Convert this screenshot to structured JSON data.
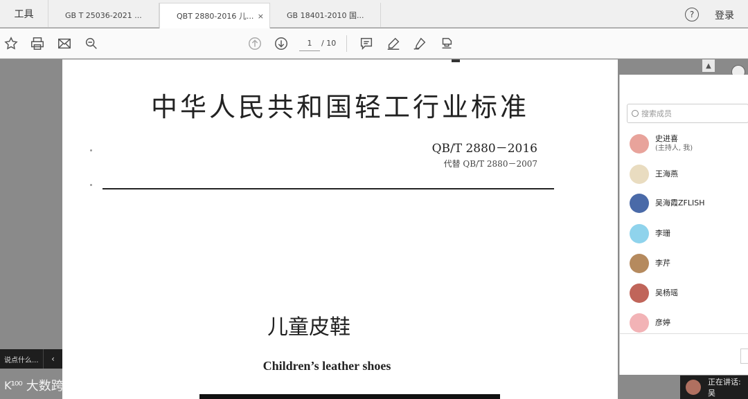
{
  "tabs": {
    "tools_label": "工具",
    "items": [
      {
        "label": "GB T 25036-2021 ..."
      },
      {
        "label": "QBT 2880-2016 儿...",
        "close": "×"
      },
      {
        "label": "GB 18401-2010 国..."
      }
    ],
    "help_icon": "?",
    "login_label": "登录"
  },
  "toolbar": {
    "icons": [
      "star-icon",
      "print-icon",
      "mail-icon",
      "zoom-icon",
      "page-up-icon",
      "page-down-icon",
      "comment-icon",
      "highlight-icon",
      "sign-icon",
      "stamp-icon"
    ],
    "current_page": "1",
    "total_pages": "/ 10"
  },
  "document": {
    "title": "中华人民共和国轻工行业标准",
    "code": "QB/T 2880－2016",
    "replaces": "代替 QB/T 2880－2007",
    "name_cn": "儿童皮鞋",
    "name_en": "Children’s leather shoes"
  },
  "comment_bar": {
    "placeholder": "说点什么...",
    "collapse_icon": "‹"
  },
  "watermark": {
    "logo": "K¹⁰⁰",
    "text": "大数跨境"
  },
  "member_panel": {
    "search_placeholder": "搜索成员",
    "members": [
      {
        "name": "史进喜",
        "role": "(主持人, 我)",
        "avatar_color": "#e8a39b"
      },
      {
        "name": "王海燕",
        "role": "",
        "avatar_color": "#e9dcc0"
      },
      {
        "name": "吴海霞ZFLISH",
        "role": "",
        "avatar_color": "#4a6aa8"
      },
      {
        "name": "李珊",
        "role": "",
        "avatar_color": "#8fd3ec"
      },
      {
        "name": "李芹",
        "role": "",
        "avatar_color": "#b58a5e"
      },
      {
        "name": "吴杨瑶",
        "role": "",
        "avatar_color": "#c0655a"
      },
      {
        "name": "彦婷",
        "role": "",
        "avatar_color": "#f2b3b6"
      }
    ]
  },
  "status": {
    "speaking_text": "正在讲话: 吴"
  }
}
